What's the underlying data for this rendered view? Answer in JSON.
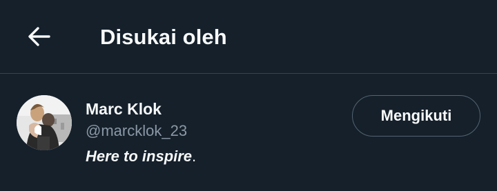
{
  "header": {
    "back_icon": "arrow-left-icon",
    "title": "Disukai oleh"
  },
  "user": {
    "display_name": "Marc Klok",
    "handle": "@marcklok_23",
    "bio_emphasis": "Here to inspire",
    "bio_suffix": ".",
    "follow_label": "Mengikuti"
  },
  "colors": {
    "background": "#15202b",
    "divider": "#38444d",
    "text_primary": "#f7f9f9",
    "text_secondary": "#8b98a5",
    "button_border": "#536471"
  }
}
